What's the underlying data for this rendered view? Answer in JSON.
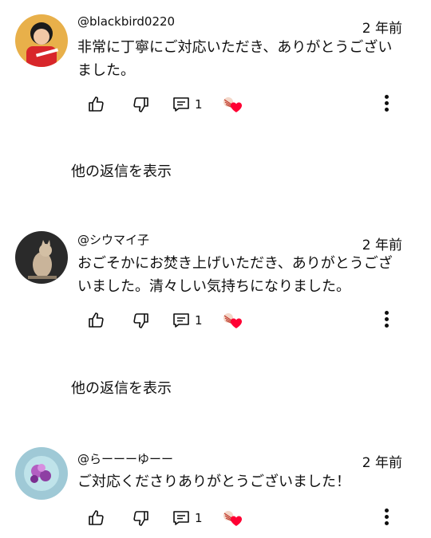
{
  "comments": [
    {
      "handle": "@blackbird0220",
      "time": "2 年前",
      "text": "非常に丁寧にご対応いただき、ありがとうございました。",
      "reply_count": "1"
    },
    {
      "handle": "@シウマイ子",
      "time": "2 年前",
      "text": "おごそかにお焚き上げいただき、ありがとうございました。清々しい気持ちになりました。",
      "reply_count": "1"
    },
    {
      "handle": "@らーーーゆーー",
      "time": "2 年前",
      "text": "ご対応くださりありがとうございました！",
      "reply_count": "1"
    }
  ],
  "more_replies_label": "他の返信を表示",
  "icons": [
    "like-icon",
    "dislike-icon",
    "reply-icon",
    "creator-heart-icon",
    "more-vert-icon"
  ],
  "colors": {
    "text": "#0f0f0f",
    "heart": "#ff0033",
    "background": "#ffffff"
  }
}
